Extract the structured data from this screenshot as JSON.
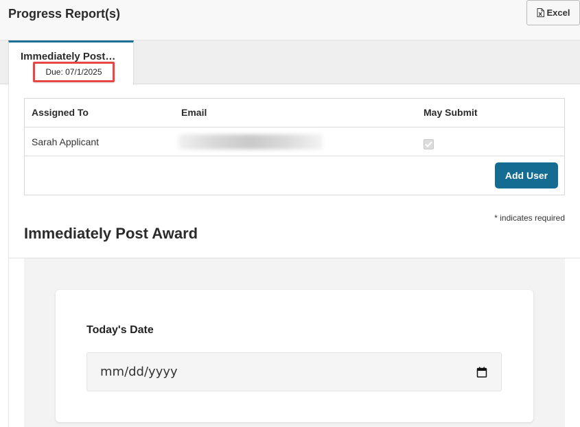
{
  "header": {
    "title": "Progress Report(s)",
    "export_button": {
      "label": "Excel",
      "icon": "excel-file-icon"
    }
  },
  "tabs": [
    {
      "label": "Immediately Post…",
      "due": "Due: 07/1/2025",
      "active": true
    }
  ],
  "users_table": {
    "columns": [
      "Assigned To",
      "Email",
      "May Submit"
    ],
    "rows": [
      {
        "assigned_to": "Sarah Applicant",
        "email": "",
        "may_submit": true
      }
    ],
    "add_user_label": "Add User"
  },
  "form": {
    "required_note": "* indicates required",
    "section_title": "Immediately Post Award",
    "fields": [
      {
        "label": "Today's Date",
        "placeholder": "mm/dd/yyyy",
        "icon": "calendar-icon"
      }
    ]
  },
  "colors": {
    "accent": "#146c92",
    "tab_border": "#1b6f93",
    "highlight": "#e84545"
  }
}
